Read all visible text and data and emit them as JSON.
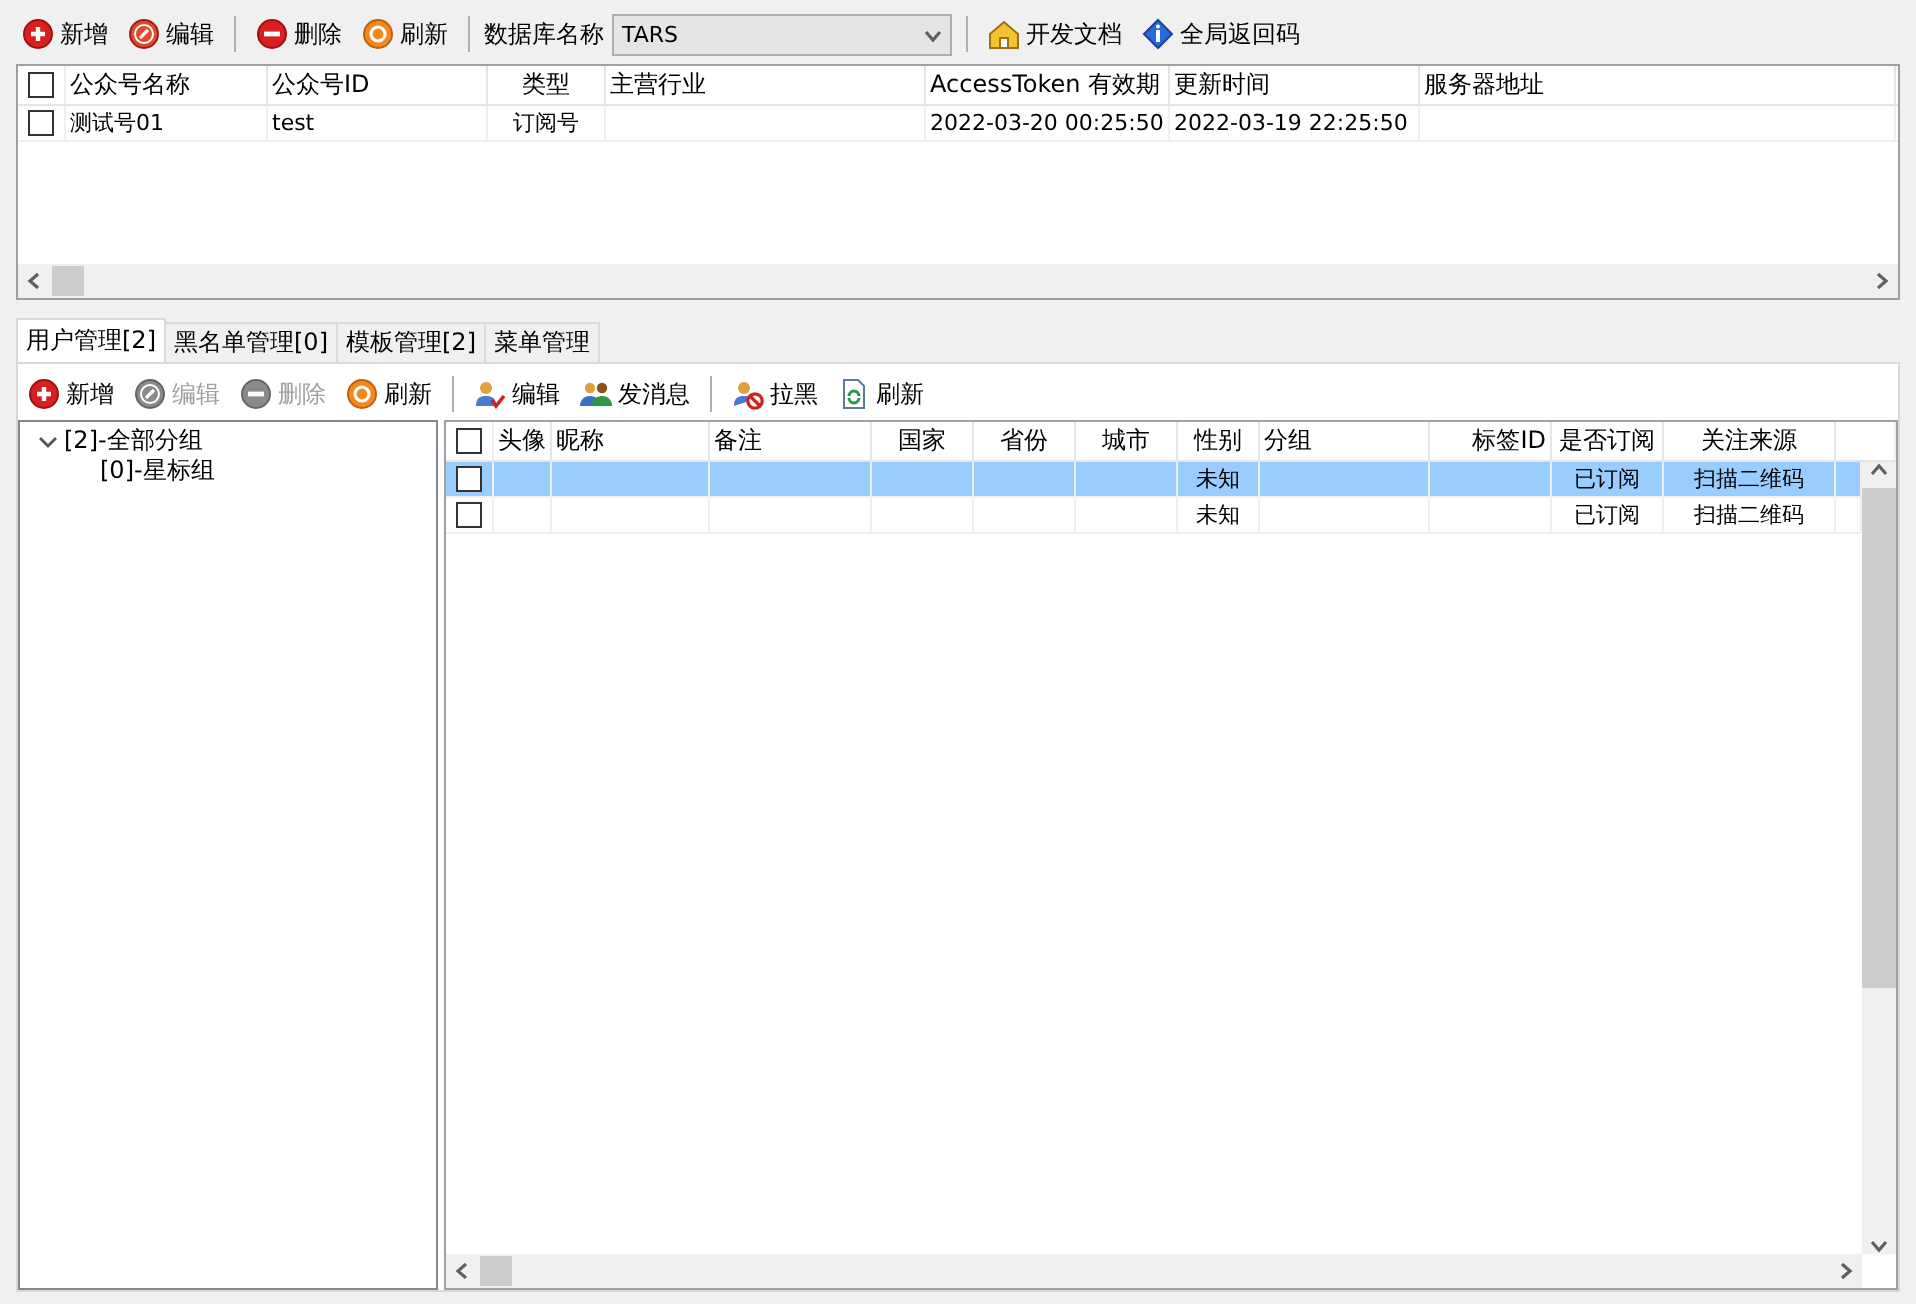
{
  "top_toolbar": {
    "actions": [
      {
        "label": "新增"
      },
      {
        "label": "编辑"
      },
      {
        "label": "删除"
      },
      {
        "label": "刷新"
      }
    ],
    "db_label": "数据库名称",
    "db_select": {
      "value": "TARS"
    },
    "links": [
      {
        "label": "开发文档"
      },
      {
        "label": "全局返回码"
      }
    ]
  },
  "accounts_table": {
    "all_checked": false,
    "columns": [
      "公众号名称",
      "公众号ID",
      "类型",
      "主营行业",
      "AccessToken 有效期",
      "更新时间",
      "服务器地址"
    ],
    "rows": [
      {
        "checked": false,
        "selected": false,
        "cells": [
          "测试号01",
          "test",
          "订阅号",
          "",
          "2022-03-20 00:25:50",
          "2022-03-19 22:25:50",
          ""
        ]
      }
    ]
  },
  "tabs": [
    {
      "label": "用户管理[2]",
      "selected": true
    },
    {
      "label": "黑名单管理[0]",
      "selected": false
    },
    {
      "label": "模板管理[2]",
      "selected": false
    },
    {
      "label": "菜单管理",
      "selected": false
    }
  ],
  "user_toolbar": [
    {
      "label": "新增",
      "disabled": false
    },
    {
      "label": "编辑",
      "disabled": true
    },
    {
      "label": "删除",
      "disabled": true
    },
    {
      "label": "刷新",
      "disabled": false
    },
    {
      "label": "编辑",
      "disabled": false
    },
    {
      "label": "发消息",
      "disabled": false
    },
    {
      "label": "拉黑",
      "disabled": false
    },
    {
      "label": "刷新",
      "disabled": false
    }
  ],
  "group_tree": [
    {
      "label": "[2]-全部分组",
      "expanded": true,
      "children": [
        {
          "label": "[0]-星标组"
        }
      ]
    }
  ],
  "users_table": {
    "all_checked": false,
    "columns": [
      "头像",
      "昵称",
      "备注",
      "国家",
      "省份",
      "城市",
      "性别",
      "分组",
      "标签ID",
      "是否订阅",
      "关注来源"
    ],
    "rows": [
      {
        "checked": false,
        "selected": true,
        "cells": [
          "",
          "",
          "",
          "",
          "",
          "",
          "未知",
          "",
          "",
          "已订阅",
          "扫描二维码"
        ]
      },
      {
        "checked": false,
        "selected": false,
        "cells": [
          "",
          "",
          "",
          "",
          "",
          "",
          "未知",
          "",
          "",
          "已订阅",
          "扫描二维码"
        ]
      }
    ]
  }
}
